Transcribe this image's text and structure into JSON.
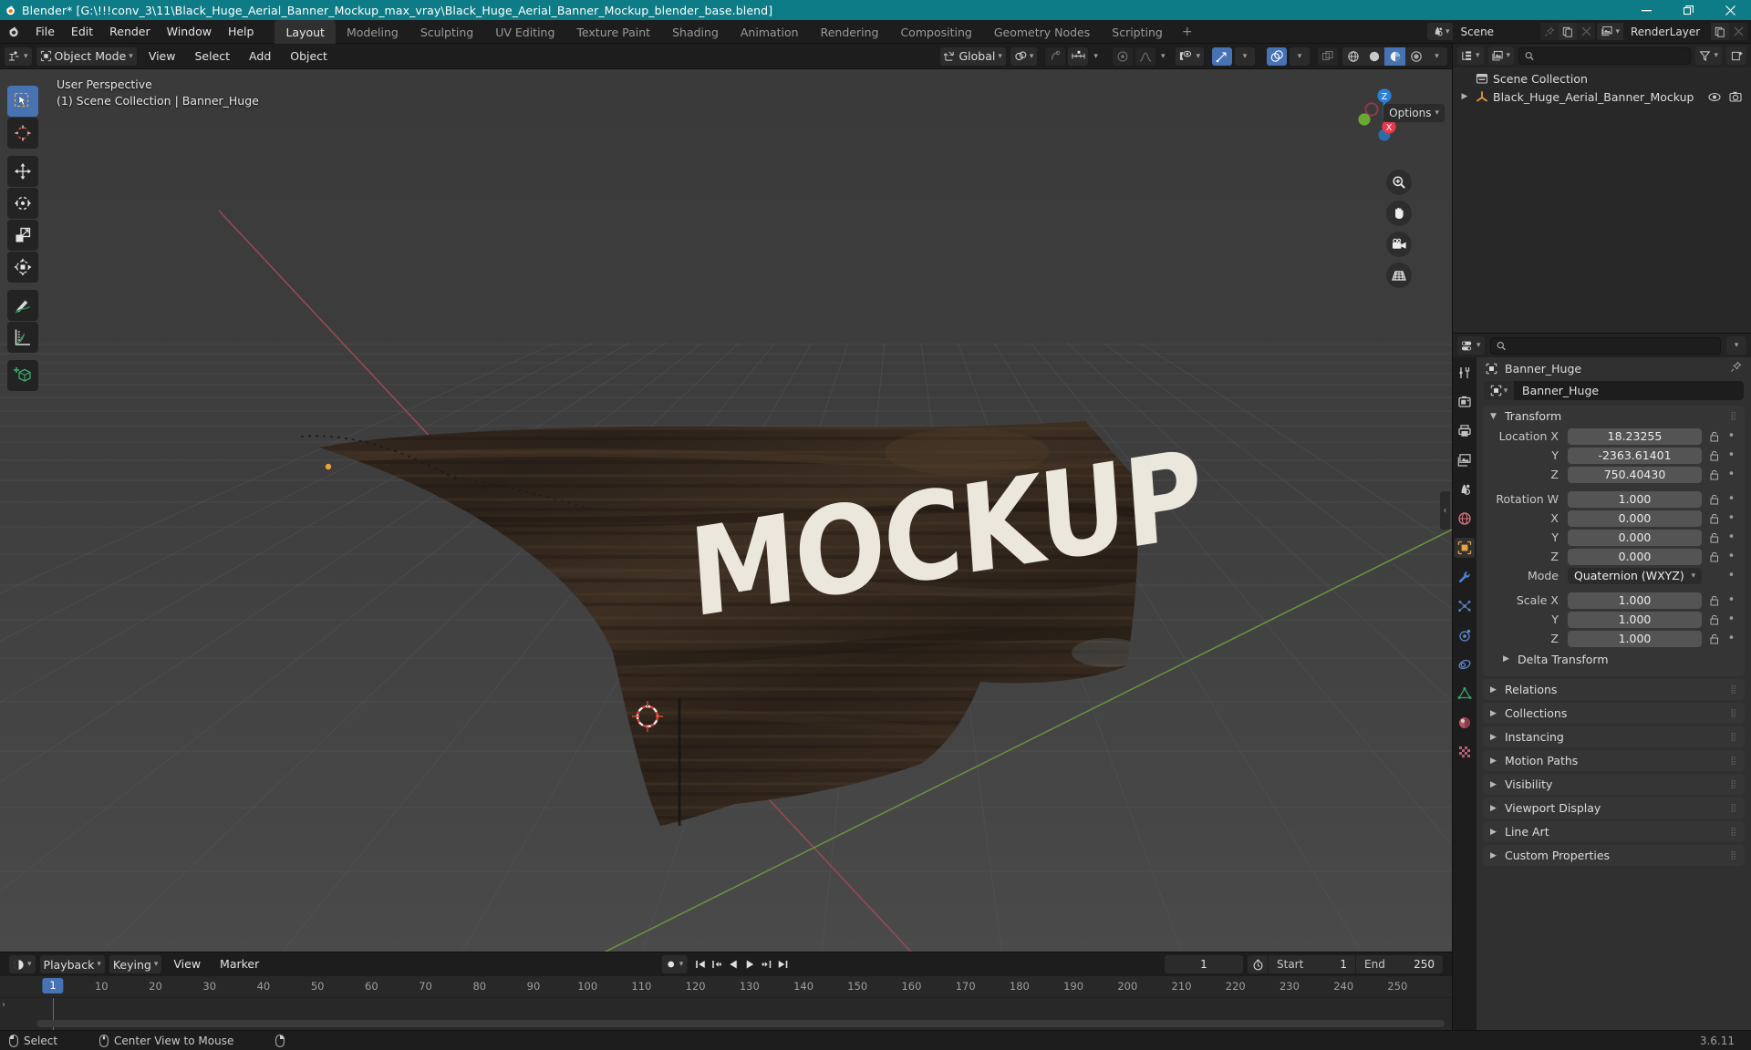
{
  "titlebar": {
    "title": "Blender* [G:\\!!!conv_3\\11\\Black_Huge_Aerial_Banner_Mockup_max_vray\\Black_Huge_Aerial_Banner_Mockup_blender_base.blend]",
    "minimize": "minimize-icon",
    "restore": "restore-icon",
    "close": "close-icon",
    "accent": "#0e7c86"
  },
  "topbar": {
    "menus": [
      "File",
      "Edit",
      "Render",
      "Window",
      "Help"
    ],
    "workspaces": [
      {
        "label": "Layout",
        "active": true
      },
      {
        "label": "Modeling",
        "active": false
      },
      {
        "label": "Sculpting",
        "active": false
      },
      {
        "label": "UV Editing",
        "active": false
      },
      {
        "label": "Texture Paint",
        "active": false
      },
      {
        "label": "Shading",
        "active": false
      },
      {
        "label": "Animation",
        "active": false
      },
      {
        "label": "Rendering",
        "active": false
      },
      {
        "label": "Compositing",
        "active": false
      },
      {
        "label": "Geometry Nodes",
        "active": false
      },
      {
        "label": "Scripting",
        "active": false
      }
    ],
    "add_workspace": "+",
    "scene": {
      "name": "Scene",
      "icon": "scene-icon"
    },
    "view_layer": {
      "name": "RenderLayer",
      "icon": "view-layer-icon"
    }
  },
  "viewport_header": {
    "editor_type": "editor-type-icon",
    "mode": "Object Mode",
    "menus": [
      "View",
      "Select",
      "Add",
      "Object"
    ],
    "transform_orientation": "Global",
    "select_modes": [
      "set",
      "extend",
      "subtract",
      "invert",
      "intersect"
    ],
    "gizmo_label": "gizmo-icon",
    "overlays_label": "overlays-icon",
    "xray_label": "xray-icon",
    "shading_modes": [
      "wireframe",
      "solid",
      "material-preview",
      "rendered"
    ],
    "active_shading": "material-preview",
    "options": "Options"
  },
  "viewport": {
    "perspective": "User Perspective",
    "scene_info": "(1) Scene Collection | Banner_Huge",
    "object_text": "MOCKUP",
    "gizmo_axes": [
      "X",
      "Y",
      "Z"
    ],
    "nav_buttons": [
      "zoom-icon",
      "hand-icon",
      "camera-icon",
      "grid-icon"
    ],
    "tools": [
      "tweak-select-tool",
      "cursor-tool",
      "move-tool",
      "rotate-tool",
      "scale-tool",
      "transform-tool",
      "annotate-tool",
      "measure-tool",
      "add-cube-tool"
    ],
    "active_tool": "tweak-select-tool"
  },
  "outliner": {
    "display_mode": "View Layer",
    "search_placeholder": "",
    "filter": "filter-icon",
    "new_collection": "new-collection-icon",
    "rows": [
      {
        "label": "Scene Collection",
        "icon": "collection-icon",
        "indent": 0,
        "expandable": false
      },
      {
        "label": "Black_Huge_Aerial_Banner_Mockup",
        "icon": "empty-axes-icon",
        "indent": 1,
        "expandable": true
      }
    ]
  },
  "properties": {
    "search_placeholder": "",
    "breadcrumb_object": "Banner_Huge",
    "id_name": "Banner_Huge",
    "tabs": [
      {
        "name": "tool-tab",
        "active": false
      },
      {
        "name": "render-tab",
        "active": false
      },
      {
        "name": "output-tab",
        "active": false
      },
      {
        "name": "view-layer-tab",
        "active": false
      },
      {
        "name": "scene-tab",
        "active": false
      },
      {
        "name": "world-tab",
        "active": false
      },
      {
        "name": "object-tab",
        "active": true
      },
      {
        "name": "modifier-tab",
        "active": false
      },
      {
        "name": "particles-tab",
        "active": false
      },
      {
        "name": "physics-tab",
        "active": false
      },
      {
        "name": "constraints-tab",
        "active": false
      },
      {
        "name": "object-data-tab",
        "active": false
      },
      {
        "name": "material-tab",
        "active": false
      },
      {
        "name": "texture-tab",
        "active": false
      }
    ],
    "transform_panel": "Transform",
    "fields": [
      {
        "label": "Location X",
        "value": "18.23255"
      },
      {
        "label": "Y",
        "value": "-2363.61401"
      },
      {
        "label": "Z",
        "value": "750.40430"
      },
      {
        "label": "Rotation W",
        "value": "1.000"
      },
      {
        "label": "X",
        "value": "0.000"
      },
      {
        "label": "Y",
        "value": "0.000"
      },
      {
        "label": "Z",
        "value": "0.000"
      }
    ],
    "mode_label": "Mode",
    "mode_value": "Quaternion (WXYZ)",
    "scale_fields": [
      {
        "label": "Scale X",
        "value": "1.000"
      },
      {
        "label": "Y",
        "value": "1.000"
      },
      {
        "label": "Z",
        "value": "1.000"
      }
    ],
    "delta_transform": "Delta Transform",
    "panels": [
      "Relations",
      "Collections",
      "Instancing",
      "Motion Paths",
      "Visibility",
      "Viewport Display",
      "Line Art",
      "Custom Properties"
    ]
  },
  "timeline": {
    "editor_icon": "timeline-icon",
    "menus": [
      "Playback",
      "Keying",
      "View",
      "Marker"
    ],
    "auto_key": "auto-keying-icon",
    "transport": [
      "jump-start",
      "prev-keyframe",
      "play-reverse",
      "play",
      "next-keyframe",
      "jump-end"
    ],
    "current_frame": "1",
    "start_label": "Start",
    "start_value": "1",
    "end_label": "End",
    "end_value": "250",
    "ticks": [
      {
        "label": "1",
        "frame": 1,
        "current": true
      },
      {
        "label": "10",
        "frame": 10
      },
      {
        "label": "20",
        "frame": 20
      },
      {
        "label": "30",
        "frame": 30
      },
      {
        "label": "40",
        "frame": 40
      },
      {
        "label": "50",
        "frame": 50
      },
      {
        "label": "60",
        "frame": 60
      },
      {
        "label": "70",
        "frame": 70
      },
      {
        "label": "80",
        "frame": 80
      },
      {
        "label": "90",
        "frame": 90
      },
      {
        "label": "100",
        "frame": 100
      },
      {
        "label": "110",
        "frame": 110
      },
      {
        "label": "120",
        "frame": 120
      },
      {
        "label": "130",
        "frame": 130
      },
      {
        "label": "140",
        "frame": 140
      },
      {
        "label": "150",
        "frame": 150
      },
      {
        "label": "160",
        "frame": 160
      },
      {
        "label": "170",
        "frame": 170
      },
      {
        "label": "180",
        "frame": 180
      },
      {
        "label": "190",
        "frame": 190
      },
      {
        "label": "200",
        "frame": 200
      },
      {
        "label": "210",
        "frame": 210
      },
      {
        "label": "220",
        "frame": 220
      },
      {
        "label": "230",
        "frame": 230
      },
      {
        "label": "240",
        "frame": 240
      },
      {
        "label": "250",
        "frame": 250
      }
    ]
  },
  "statusbar": {
    "hint1": "Select",
    "hint2": "Center View to Mouse",
    "version": "3.6.11"
  }
}
